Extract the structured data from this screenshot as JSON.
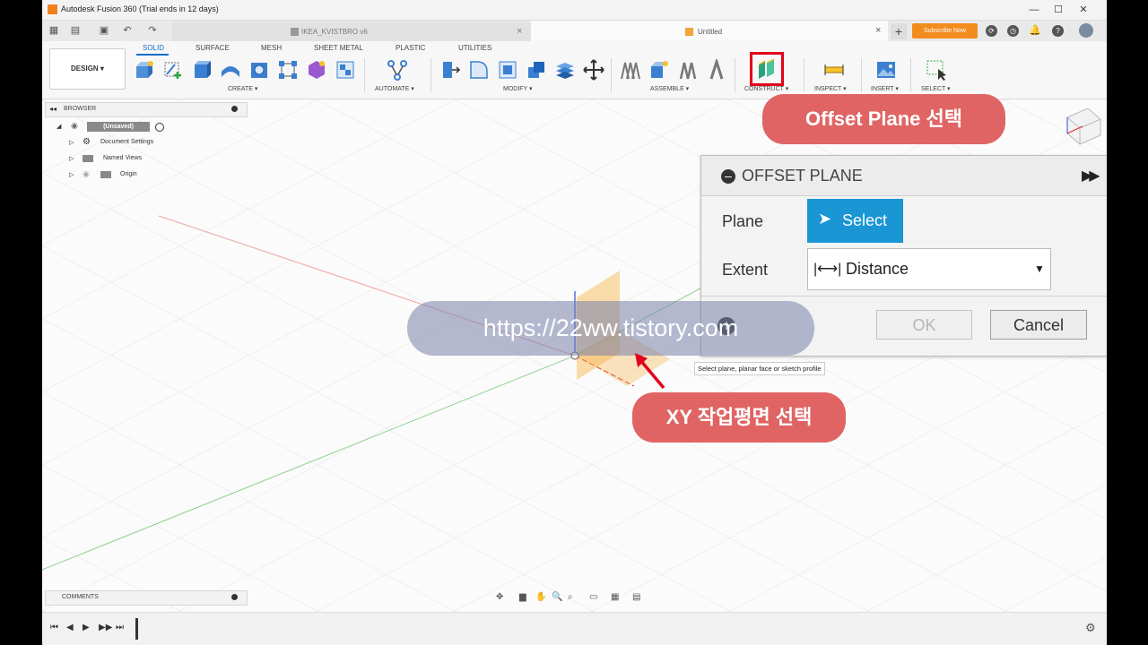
{
  "titlebar": {
    "title": "Autodesk Fusion 360 (Trial ends in 12 days)",
    "min": "—",
    "max": "☐",
    "close": "✕"
  },
  "tabs": {
    "doc1": "IKEA_KVISTBRO v6",
    "doc2": "Untitled",
    "close": "×",
    "add": "+",
    "subscribe": "Subscribe Now"
  },
  "ribbon": {
    "design": "DESIGN ▾",
    "tabs": [
      "SOLID",
      "SURFACE",
      "MESH",
      "SHEET METAL",
      "PLASTIC",
      "UTILITIES"
    ],
    "groups": [
      "CREATE ▾",
      "AUTOMATE ▾",
      "MODIFY ▾",
      "ASSEMBLE ▾",
      "CONSTRUCT ▾",
      "INSPECT ▾",
      "INSERT ▾",
      "SELECT ▾"
    ]
  },
  "browser": {
    "title": "BROWSER",
    "root": "(Unsaved)",
    "items": [
      "Document Settings",
      "Named Views",
      "Origin"
    ]
  },
  "comments": {
    "title": "COMMENTS"
  },
  "dialog": {
    "title": "OFFSET PLANE",
    "plane_label": "Plane",
    "select_label": "Select",
    "extent_label": "Extent",
    "extent_value": "Distance",
    "ok": "OK",
    "cancel": "Cancel"
  },
  "tooltip": "Select plane, planar face or sketch profile",
  "callouts": {
    "offset_plane": "Offset Plane 선택",
    "xy_plane": "XY 작업평면 선택"
  },
  "watermark": "https://22ww.tistory.com",
  "colors": {
    "accent": "#0d6fc8",
    "select_button": "#1a96d5",
    "callout": "#e06464",
    "subscribe": "#f28c1e",
    "highlight": "#e3001b"
  }
}
